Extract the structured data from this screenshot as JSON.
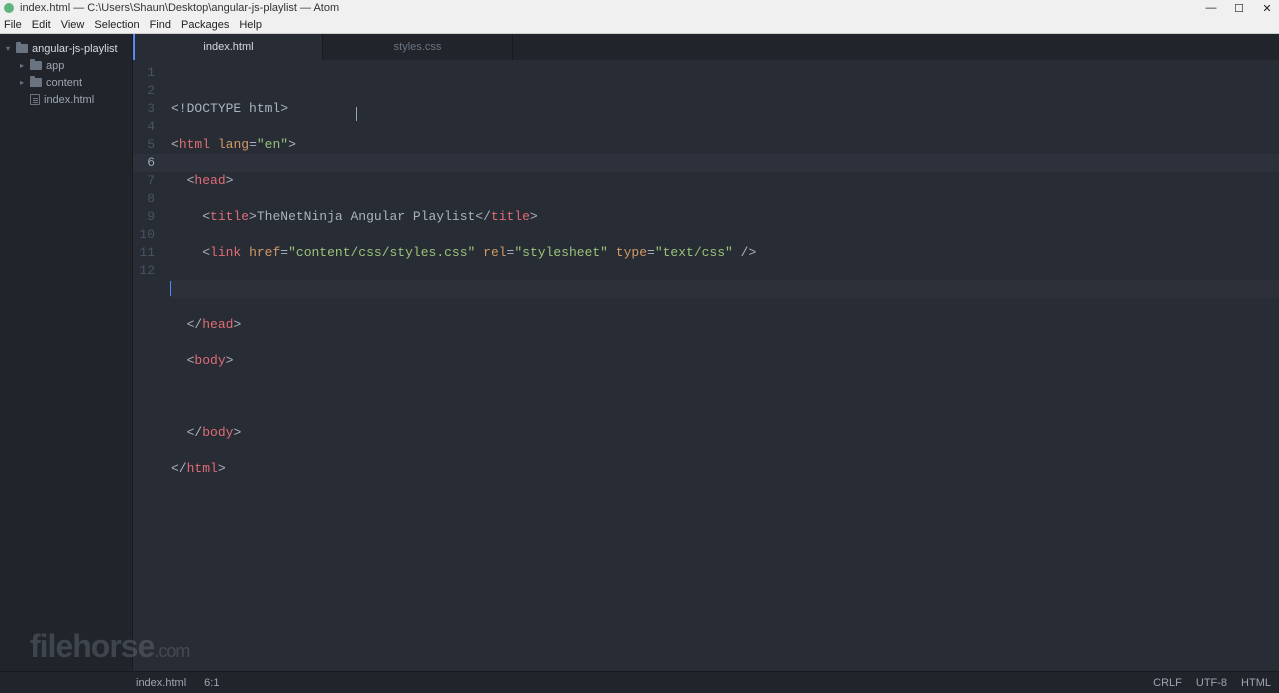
{
  "window": {
    "title": "index.html — C:\\Users\\Shaun\\Desktop\\angular-js-playlist — Atom"
  },
  "menu": [
    "File",
    "Edit",
    "View",
    "Selection",
    "Find",
    "Packages",
    "Help"
  ],
  "tree": {
    "root": "angular-js-playlist",
    "items": [
      {
        "name": "app",
        "type": "folder"
      },
      {
        "name": "content",
        "type": "folder"
      },
      {
        "name": "index.html",
        "type": "file"
      }
    ]
  },
  "tabs": [
    {
      "label": "index.html",
      "active": true
    },
    {
      "label": "styles.css",
      "active": false
    }
  ],
  "editor": {
    "line_numbers": [
      "1",
      "2",
      "3",
      "4",
      "5",
      "6",
      "7",
      "8",
      "9",
      "10",
      "11",
      "12"
    ],
    "current_line": 6,
    "cursor_column": 1,
    "code": {
      "l1": {
        "pre": "<!",
        "tag": "DOCTYPE html",
        "post": ">"
      },
      "l2": {
        "open": "<",
        "tag": "html",
        "sp": " ",
        "attr": "lang",
        "eq": "=",
        "str": "\"en\"",
        "close": ">"
      },
      "l3": {
        "indent": "  ",
        "open": "<",
        "tag": "head",
        "close": ">"
      },
      "l4": {
        "indent": "    ",
        "open": "<",
        "tag": "title",
        "close": ">",
        "text": "TheNetNinja Angular Playlist",
        "open2": "</",
        "tag2": "title",
        "close2": ">"
      },
      "l5": {
        "indent": "    ",
        "open": "<",
        "tag": "link",
        "sp": " ",
        "attr1": "href",
        "eq1": "=",
        "str1": "\"content/css/styles.css\"",
        "sp2": " ",
        "attr2": "rel",
        "eq2": "=",
        "str2": "\"stylesheet\"",
        "sp3": " ",
        "attr3": "type",
        "eq3": "=",
        "str3": "\"text/css\"",
        "close": " />"
      },
      "l6": {
        "indent": ""
      },
      "l7": {
        "indent": "  ",
        "open": "</",
        "tag": "head",
        "close": ">"
      },
      "l8": {
        "indent": "  ",
        "open": "<",
        "tag": "body",
        "close": ">"
      },
      "l9": {
        "indent": ""
      },
      "l10": {
        "indent": "  ",
        "open": "</",
        "tag": "body",
        "close": ">"
      },
      "l11": {
        "open": "</",
        "tag": "html",
        "close": ">"
      },
      "l12": {
        "indent": ""
      }
    }
  },
  "status": {
    "file": "index.html",
    "position": "6:1",
    "line_ending": "CRLF",
    "encoding": "UTF-8",
    "grammar": "HTML"
  },
  "watermark": {
    "main": "filehorse",
    "suffix": ".com"
  }
}
